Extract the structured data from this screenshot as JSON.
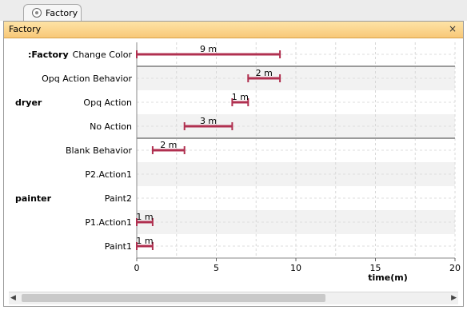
{
  "tab": {
    "label": "Factory"
  },
  "panel": {
    "title": "Factory"
  },
  "chart_data": {
    "type": "gantt",
    "xlabel": "time(m)",
    "xlim": [
      0,
      20
    ],
    "xticks": [
      "0",
      "5",
      "10",
      "15",
      "20"
    ],
    "groups": [
      ":Factory",
      "dryer",
      "painter"
    ],
    "rows": [
      {
        "group": ":Factory",
        "label": "Change Color",
        "start": 0,
        "end": 9,
        "duration_label": "9 m"
      },
      {
        "group": "dryer",
        "label": "Opq Action Behavior",
        "start": 7,
        "end": 9,
        "duration_label": "2 m"
      },
      {
        "group": "dryer",
        "label": "Opq Action",
        "start": 6,
        "end": 7,
        "duration_label": "1 m"
      },
      {
        "group": "dryer",
        "label": "No Action",
        "start": 3,
        "end": 6,
        "duration_label": "3 m"
      },
      {
        "group": "painter",
        "label": "Blank Behavior",
        "start": 1,
        "end": 3,
        "duration_label": "2 m"
      },
      {
        "group": "painter",
        "label": "P2.Action1",
        "start": null,
        "end": null,
        "duration_label": ""
      },
      {
        "group": "painter",
        "label": "Paint2",
        "start": null,
        "end": null,
        "duration_label": ""
      },
      {
        "group": "painter",
        "label": "P1.Action1",
        "start": 0,
        "end": 1,
        "duration_label": "1 m"
      },
      {
        "group": "painter",
        "label": "Paint1",
        "start": 0,
        "end": 1,
        "duration_label": "1 m"
      }
    ],
    "bar_color": "#b03050"
  }
}
